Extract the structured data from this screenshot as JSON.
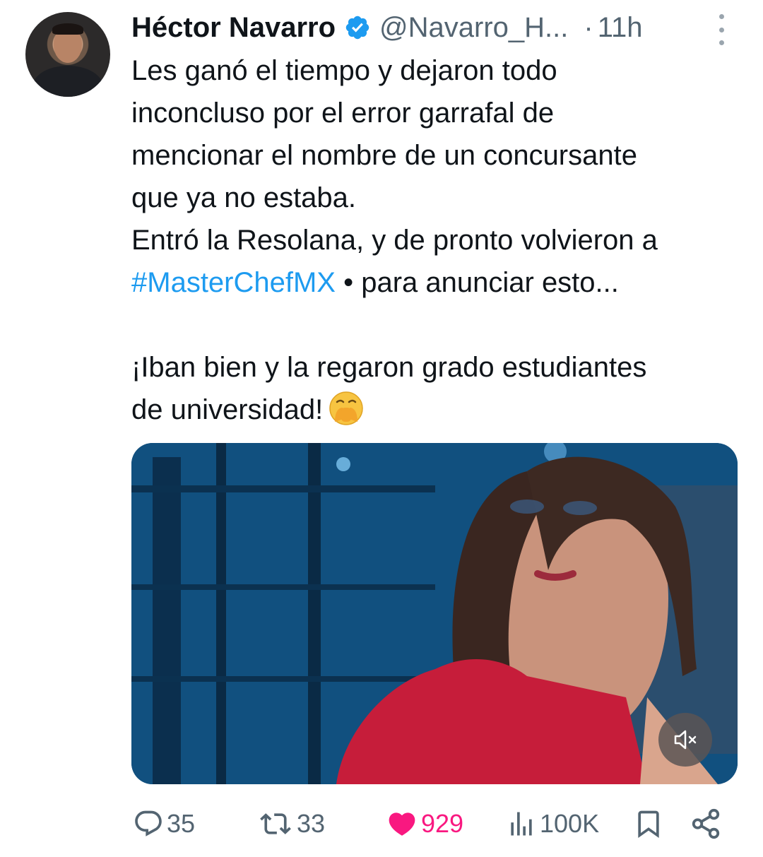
{
  "tweet": {
    "author_name": "Héctor Navarro",
    "handle": "@Navarro_H...",
    "separator": "·",
    "time": "11h",
    "text_lines": [
      "Les ganó el tiempo y dejaron todo",
      "inconcluso por el error garrafal de",
      "mencionar el nombre de un concursante",
      "que ya no estaba.",
      "Entró la Resolana, y de pronto volvieron a"
    ],
    "hashtag": "#MasterChefMX",
    "hashtag_tail": " • para anunciar esto...",
    "closing_lines": [
      "¡Iban bien y la regaron grado estudiantes",
      "de universidad!"
    ]
  },
  "actions": {
    "replies": "35",
    "reposts": "33",
    "likes": "929",
    "views": "100K"
  },
  "colors": {
    "accent": "#1d9bf0",
    "like": "#f91880",
    "muted": "#536471"
  },
  "icons": [
    "verified-badge-icon",
    "more-options-icon",
    "mute-icon",
    "reply-icon",
    "repost-icon",
    "like-icon",
    "views-icon",
    "bookmark-icon",
    "share-icon",
    "face-with-hand-over-mouth-emoji"
  ]
}
